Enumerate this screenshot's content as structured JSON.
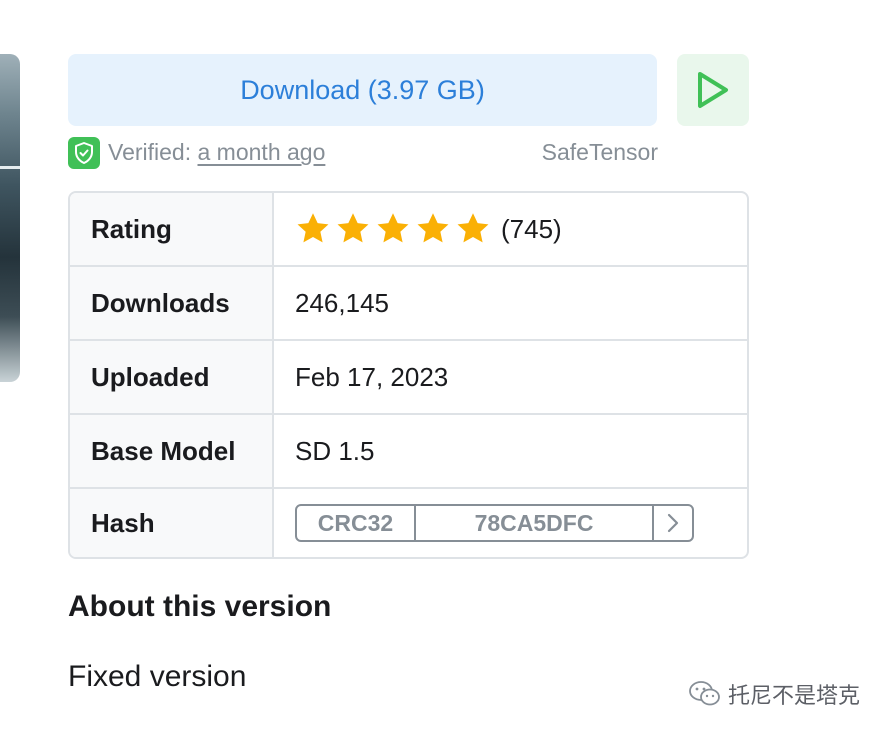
{
  "download": {
    "label": "Download (3.97 GB)"
  },
  "verified": {
    "prefix": "Verified: ",
    "link": "a month ago",
    "format": "SafeTensor"
  },
  "details": {
    "rating": {
      "label": "Rating",
      "stars": 5,
      "count": "(745)"
    },
    "downloads": {
      "label": "Downloads",
      "value": "246,145"
    },
    "uploaded": {
      "label": "Uploaded",
      "value": "Feb 17, 2023"
    },
    "base_model": {
      "label": "Base Model",
      "value": "SD 1.5"
    },
    "hash": {
      "label": "Hash",
      "type": "CRC32",
      "value": "78CA5DFC"
    }
  },
  "about": {
    "title": "About this version",
    "body": "Fixed version"
  },
  "watermark": {
    "text": "托尼不是塔克"
  },
  "colors": {
    "accent": "#2c7fd9",
    "download_bg": "#e6f2fd",
    "play_green": "#40c057",
    "star": "#fab005",
    "muted": "#868e96"
  },
  "icons": [
    "play-icon",
    "shield-check-icon",
    "star-icon",
    "chevron-right-icon",
    "wechat-icon"
  ]
}
